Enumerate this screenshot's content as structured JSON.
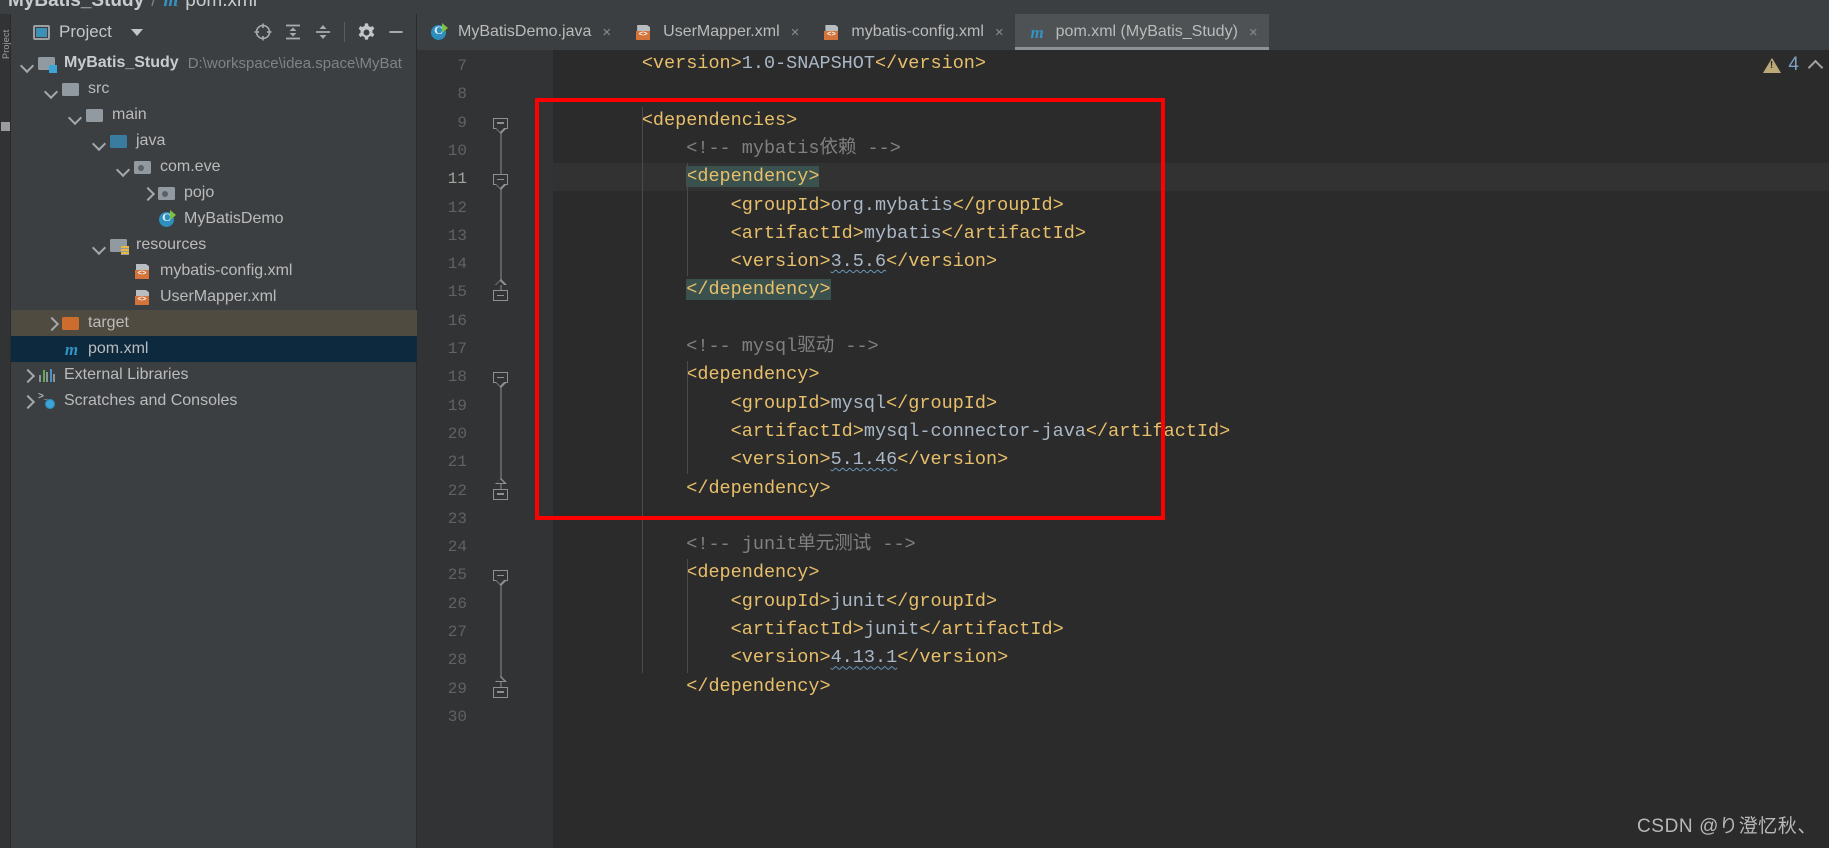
{
  "breadcrumb": {
    "project": "MyBatis_Study",
    "separator": "/",
    "maven_icon": "m",
    "file": "pom.xml"
  },
  "far_rail": {
    "label": "Project",
    "icon": "structure-square"
  },
  "project_panel": {
    "title": "Project",
    "caret_icon": "chevron-down-icon",
    "toolbar": [
      {
        "name": "select-opened-file-icon",
        "glyph": "target"
      },
      {
        "name": "expand-all-icon",
        "glyph": "expand"
      },
      {
        "name": "collapse-all-icon",
        "glyph": "collapse"
      },
      {
        "name": "settings-gear-icon",
        "glyph": "gear"
      },
      {
        "name": "hide-panel-icon",
        "glyph": "minus"
      }
    ],
    "tree": [
      {
        "label": "MyBatis_Study",
        "path": "D:\\workspace\\idea.space\\MyBat",
        "indent": 0,
        "arrow": "down",
        "icon": "module-folder",
        "bold": true,
        "state": "none"
      },
      {
        "label": "src",
        "path": "",
        "indent": 1,
        "arrow": "down",
        "icon": "folder-gray",
        "bold": false,
        "state": "none"
      },
      {
        "label": "main",
        "path": "",
        "indent": 2,
        "arrow": "down",
        "icon": "folder-gray",
        "bold": false,
        "state": "none"
      },
      {
        "label": "java",
        "path": "",
        "indent": 3,
        "arrow": "down",
        "icon": "folder-blue",
        "bold": false,
        "state": "none"
      },
      {
        "label": "com.eve",
        "path": "",
        "indent": 4,
        "arrow": "down",
        "icon": "package",
        "bold": false,
        "state": "none"
      },
      {
        "label": "pojo",
        "path": "",
        "indent": 5,
        "arrow": "right",
        "icon": "package",
        "bold": false,
        "state": "none"
      },
      {
        "label": "MyBatisDemo",
        "path": "",
        "indent": 5,
        "arrow": "none",
        "icon": "java-class",
        "bold": false,
        "state": "none"
      },
      {
        "label": "resources",
        "path": "",
        "indent": 3,
        "arrow": "down",
        "icon": "folder-resources",
        "bold": false,
        "state": "none"
      },
      {
        "label": "mybatis-config.xml",
        "path": "",
        "indent": 4,
        "arrow": "none",
        "icon": "xml-file",
        "bold": false,
        "state": "none"
      },
      {
        "label": "UserMapper.xml",
        "path": "",
        "indent": 4,
        "arrow": "none",
        "icon": "xml-file",
        "bold": false,
        "state": "none"
      },
      {
        "label": "target",
        "path": "",
        "indent": 1,
        "arrow": "right",
        "icon": "folder-orange",
        "bold": false,
        "state": "hover"
      },
      {
        "label": "pom.xml",
        "path": "",
        "indent": 1,
        "arrow": "none",
        "icon": "maven-file",
        "bold": false,
        "state": "selected"
      },
      {
        "label": "External Libraries",
        "path": "",
        "indent": 0,
        "arrow": "right",
        "icon": "libraries",
        "bold": false,
        "state": "none"
      },
      {
        "label": "Scratches and Consoles",
        "path": "",
        "indent": 0,
        "arrow": "right",
        "icon": "scratches",
        "bold": false,
        "state": "none"
      }
    ]
  },
  "editor": {
    "tabs": [
      {
        "label": "MyBatisDemo.java",
        "icon": "java-class",
        "active": false,
        "close": "×"
      },
      {
        "label": "UserMapper.xml",
        "icon": "xml-file",
        "active": false,
        "close": "×"
      },
      {
        "label": "mybatis-config.xml",
        "icon": "xml-file",
        "active": false,
        "close": "×"
      },
      {
        "label": "pom.xml (MyBatis_Study)",
        "icon": "maven-file",
        "active": true,
        "close": "×"
      }
    ],
    "first_line_number": 7,
    "last_line_number": 30,
    "current_line": 11,
    "line_numbers": [
      7,
      8,
      9,
      10,
      11,
      12,
      13,
      14,
      15,
      16,
      17,
      18,
      19,
      20,
      21,
      22,
      23,
      24,
      25,
      26,
      27,
      28,
      29,
      30
    ],
    "lines": [
      {
        "n": 7,
        "indent": 2,
        "segments": [
          {
            "t": "tag",
            "v": "<version>"
          },
          {
            "t": "txt",
            "v": "1.0-SNAPSHOT"
          },
          {
            "t": "tag",
            "v": "</version>"
          }
        ]
      },
      {
        "n": 8,
        "indent": 0,
        "segments": []
      },
      {
        "n": 9,
        "indent": 2,
        "segments": [
          {
            "t": "tag",
            "v": "<dependencies>"
          }
        ]
      },
      {
        "n": 10,
        "indent": 3,
        "segments": [
          {
            "t": "cmt",
            "v": "<!-- mybatis依赖 -->"
          }
        ]
      },
      {
        "n": 11,
        "indent": 3,
        "hl": true,
        "segments": [
          {
            "t": "tag",
            "v": "<dependency>",
            "bg": true
          }
        ]
      },
      {
        "n": 12,
        "indent": 4,
        "segments": [
          {
            "t": "tag",
            "v": "<groupId>"
          },
          {
            "t": "txt",
            "v": "org.mybatis"
          },
          {
            "t": "tag",
            "v": "</groupId>"
          }
        ]
      },
      {
        "n": 13,
        "indent": 4,
        "segments": [
          {
            "t": "tag",
            "v": "<artifactId>"
          },
          {
            "t": "txt",
            "v": "mybatis"
          },
          {
            "t": "tag",
            "v": "</artifactId>"
          }
        ]
      },
      {
        "n": 14,
        "indent": 4,
        "segments": [
          {
            "t": "tag",
            "v": "<version>"
          },
          {
            "t": "txt",
            "v": "3.5.6",
            "sq": true
          },
          {
            "t": "tag",
            "v": "</version>"
          }
        ]
      },
      {
        "n": 15,
        "indent": 3,
        "segments": [
          {
            "t": "tag",
            "v": "</dependency>",
            "bg": true
          }
        ]
      },
      {
        "n": 16,
        "indent": 0,
        "segments": []
      },
      {
        "n": 17,
        "indent": 3,
        "segments": [
          {
            "t": "cmt",
            "v": "<!-- mysql驱动 -->"
          }
        ]
      },
      {
        "n": 18,
        "indent": 3,
        "segments": [
          {
            "t": "tag",
            "v": "<dependency>"
          }
        ]
      },
      {
        "n": 19,
        "indent": 4,
        "segments": [
          {
            "t": "tag",
            "v": "<groupId>"
          },
          {
            "t": "txt",
            "v": "mysql"
          },
          {
            "t": "tag",
            "v": "</groupId>"
          }
        ]
      },
      {
        "n": 20,
        "indent": 4,
        "segments": [
          {
            "t": "tag",
            "v": "<artifactId>"
          },
          {
            "t": "txt",
            "v": "mysql-connector-java"
          },
          {
            "t": "tag",
            "v": "</artifactId>"
          }
        ]
      },
      {
        "n": 21,
        "indent": 4,
        "segments": [
          {
            "t": "tag",
            "v": "<version>"
          },
          {
            "t": "txt",
            "v": "5.1.46",
            "sq": true
          },
          {
            "t": "tag",
            "v": "</version>"
          }
        ]
      },
      {
        "n": 22,
        "indent": 3,
        "segments": [
          {
            "t": "tag",
            "v": "</dependency>"
          }
        ]
      },
      {
        "n": 23,
        "indent": 0,
        "segments": []
      },
      {
        "n": 24,
        "indent": 3,
        "segments": [
          {
            "t": "cmt",
            "v": "<!-- junit单元测试 -->"
          }
        ]
      },
      {
        "n": 25,
        "indent": 3,
        "segments": [
          {
            "t": "tag",
            "v": "<dependency>"
          }
        ]
      },
      {
        "n": 26,
        "indent": 4,
        "segments": [
          {
            "t": "tag",
            "v": "<groupId>"
          },
          {
            "t": "txt",
            "v": "junit"
          },
          {
            "t": "tag",
            "v": "</groupId>"
          }
        ]
      },
      {
        "n": 27,
        "indent": 4,
        "segments": [
          {
            "t": "tag",
            "v": "<artifactId>"
          },
          {
            "t": "txt",
            "v": "junit"
          },
          {
            "t": "tag",
            "v": "</artifactId>"
          }
        ]
      },
      {
        "n": 28,
        "indent": 4,
        "segments": [
          {
            "t": "tag",
            "v": "<version>"
          },
          {
            "t": "txt",
            "v": "4.13.1",
            "sq": true
          },
          {
            "t": "tag",
            "v": "</version>"
          }
        ]
      },
      {
        "n": 29,
        "indent": 3,
        "segments": [
          {
            "t": "tag",
            "v": "</dependency>"
          }
        ]
      },
      {
        "n": 30,
        "indent": 0,
        "segments": []
      }
    ],
    "fold_markers": [
      {
        "line": 9,
        "dir": "down"
      },
      {
        "line": 11,
        "dir": "down"
      },
      {
        "line": 15,
        "dir": "up"
      },
      {
        "line": 18,
        "dir": "down"
      },
      {
        "line": 22,
        "dir": "up"
      },
      {
        "line": 25,
        "dir": "down"
      },
      {
        "line": 29,
        "dir": "up"
      }
    ],
    "annotation": {
      "type": "red-rectangle",
      "color": "#FF0000"
    }
  },
  "inspection": {
    "warning_count": "4",
    "warn_icon": "warning-triangle-icon",
    "collapse_icon": "chevron-up-icon"
  },
  "watermark": "CSDN @り澄忆秋、",
  "colors": {
    "panel_bg": "#3C3F41",
    "editor_bg": "#2B2B2B",
    "gutter_bg": "#313335",
    "tag": "#E8BF6A",
    "text": "#A9B7C6",
    "comment": "#808080",
    "selection_green": "#3B514D",
    "selected_row": "#0D293E",
    "hover_row": "#4F4B41",
    "accent_red": "#FF0000"
  }
}
